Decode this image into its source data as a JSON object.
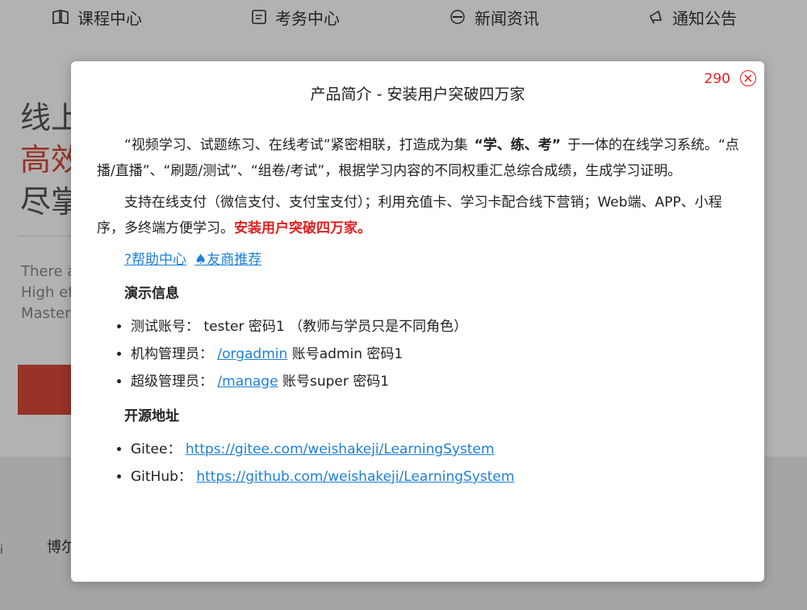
{
  "nav": {
    "items": [
      {
        "label": "课程中心",
        "icon": "book-icon"
      },
      {
        "label": "考务中心",
        "icon": "exam-icon"
      },
      {
        "label": "新闻资讯",
        "icon": "news-icon"
      },
      {
        "label": "通知公告",
        "icon": "megaphone-icon"
      }
    ]
  },
  "hero": {
    "line1": "线上",
    "line2": "高效",
    "line3": "尽掌",
    "en1": "There a",
    "en2": "High ef",
    "en3": "Master"
  },
  "footer": {
    "text": "博尔",
    "mark": "i"
  },
  "modal": {
    "countdown": "290",
    "title": "产品简介 - 安装用户突破四万家",
    "para1_a": "“视频学习、试题练习、在线考试”紧密相联，打造成为集",
    "para1_b": "“学、练、考”",
    "para1_c": "于一体的在线学习系统。“点播/直播”、“刷题/测试”、“组卷/考试”，根据学习内容的不同权重汇总综合成绩，生成学习证明。",
    "para2_a": "支持在线支付（微信支付、支付宝支付）；利用充值卡、学习卡配合线下营销；Web端、APP、小程序，多终端方便学习。",
    "para2_b": "安装用户突破四万家。",
    "link_help": "?帮助中心",
    "link_partner": "♠友商推荐",
    "demo_title": "演示信息",
    "demo_items": [
      {
        "pre": "测试账号： tester 密码1 （教师与学员只是不同角色）",
        "link": "",
        "post": ""
      },
      {
        "pre": "机构管理员： ",
        "link": "/orgadmin",
        "post": " 账号admin 密码1"
      },
      {
        "pre": "超级管理员： ",
        "link": "/manage",
        "post": " 账号super 密码1"
      }
    ],
    "source_title": "开源地址",
    "source_items": [
      {
        "pre": "Gitee： ",
        "link": "https://gitee.com/weishakeji/LearningSystem"
      },
      {
        "pre": "GitHub： ",
        "link": "https://github.com/weishakeji/LearningSystem"
      }
    ]
  },
  "colors": {
    "accent_red": "#e02020",
    "link_blue": "#1e7fd8",
    "hero_red": "#d84a38"
  }
}
